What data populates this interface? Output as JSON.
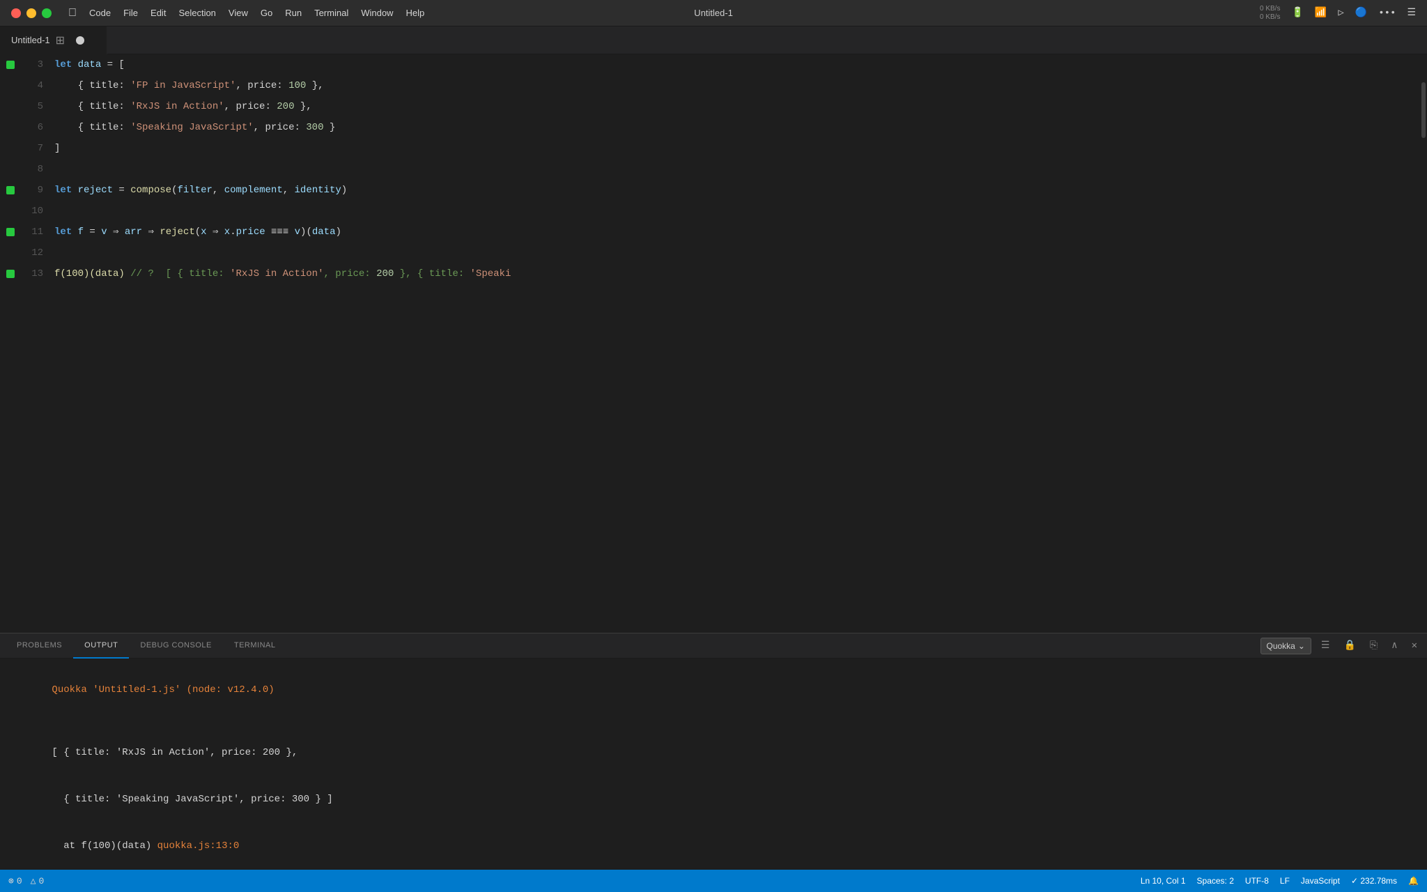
{
  "titlebar": {
    "title": "Untitled-1",
    "menu_items": [
      "",
      "Code",
      "File",
      "Edit",
      "Selection",
      "View",
      "Go",
      "Run",
      "Terminal",
      "Window",
      "Help"
    ],
    "status_kb": "0 KB/s",
    "status_kb2": "0 KB/s"
  },
  "editor": {
    "tab_label": "Untitled-1",
    "lines": [
      {
        "number": "3",
        "has_dot": true,
        "tokens": [
          {
            "text": "let ",
            "class": "kw"
          },
          {
            "text": "data",
            "class": "blue"
          },
          {
            "text": " = [",
            "class": "punct"
          }
        ]
      },
      {
        "number": "4",
        "has_dot": false,
        "tokens": [
          {
            "text": "    { title: ",
            "class": "punct"
          },
          {
            "text": "'FP in JavaScript'",
            "class": "str"
          },
          {
            "text": ", price: ",
            "class": "punct"
          },
          {
            "text": "100",
            "class": "num"
          },
          {
            "text": " },",
            "class": "punct"
          }
        ]
      },
      {
        "number": "5",
        "has_dot": false,
        "tokens": [
          {
            "text": "    { title: ",
            "class": "punct"
          },
          {
            "text": "'RxJS in Action'",
            "class": "str"
          },
          {
            "text": ", price: ",
            "class": "punct"
          },
          {
            "text": "200",
            "class": "num"
          },
          {
            "text": " },",
            "class": "punct"
          }
        ]
      },
      {
        "number": "6",
        "has_dot": false,
        "tokens": [
          {
            "text": "    { title: ",
            "class": "punct"
          },
          {
            "text": "'Speaking JavaScript'",
            "class": "str"
          },
          {
            "text": ", price: ",
            "class": "punct"
          },
          {
            "text": "300",
            "class": "num"
          },
          {
            "text": " }",
            "class": "punct"
          }
        ]
      },
      {
        "number": "7",
        "has_dot": false,
        "tokens": [
          {
            "text": "]",
            "class": "punct"
          }
        ]
      },
      {
        "number": "8",
        "has_dot": false,
        "tokens": []
      },
      {
        "number": "9",
        "has_dot": true,
        "tokens": [
          {
            "text": "let ",
            "class": "kw"
          },
          {
            "text": "reject",
            "class": "blue"
          },
          {
            "text": " = ",
            "class": "punct"
          },
          {
            "text": "compose",
            "class": "yellow"
          },
          {
            "text": "(",
            "class": "punct"
          },
          {
            "text": "filter",
            "class": "blue"
          },
          {
            "text": ", ",
            "class": "punct"
          },
          {
            "text": "complement",
            "class": "blue"
          },
          {
            "text": ", ",
            "class": "punct"
          },
          {
            "text": "identity",
            "class": "blue"
          },
          {
            "text": ")",
            "class": "punct"
          }
        ]
      },
      {
        "number": "10",
        "has_dot": false,
        "tokens": []
      },
      {
        "number": "11",
        "has_dot": true,
        "tokens": [
          {
            "text": "let ",
            "class": "kw"
          },
          {
            "text": "f",
            "class": "blue"
          },
          {
            "text": " = ",
            "class": "punct"
          },
          {
            "text": "v",
            "class": "blue"
          },
          {
            "text": " ⇒ ",
            "class": "punct"
          },
          {
            "text": "arr",
            "class": "blue"
          },
          {
            "text": " ⇒ ",
            "class": "punct"
          },
          {
            "text": "reject",
            "class": "yellow"
          },
          {
            "text": "(",
            "class": "punct"
          },
          {
            "text": "x",
            "class": "blue"
          },
          {
            "text": " ⇒ ",
            "class": "punct"
          },
          {
            "text": "x",
            "class": "blue"
          },
          {
            "text": ".",
            "class": "punct"
          },
          {
            "text": "price",
            "class": "blue"
          },
          {
            "text": " === ",
            "class": "punct"
          },
          {
            "text": "v",
            "class": "blue"
          },
          {
            "text": ")(",
            "class": "punct"
          },
          {
            "text": "data",
            "class": "blue"
          },
          {
            "text": ")",
            "class": "punct"
          }
        ]
      },
      {
        "number": "12",
        "has_dot": false,
        "tokens": []
      },
      {
        "number": "13",
        "has_dot": true,
        "tokens": [
          {
            "text": "f(100)(data) ",
            "class": "yellow"
          },
          {
            "text": "// ? ",
            "class": "comment"
          },
          {
            "text": "[ { title: ",
            "class": "comment"
          },
          {
            "text": "'RxJS in Action'",
            "class": "str"
          },
          {
            "text": ", price: ",
            "class": "comment"
          },
          {
            "text": "200",
            "class": "num"
          },
          {
            "text": " }, { title: ",
            "class": "comment"
          },
          {
            "text": "'Speaki",
            "class": "str"
          }
        ]
      }
    ]
  },
  "panel": {
    "tabs": [
      "PROBLEMS",
      "OUTPUT",
      "DEBUG CONSOLE",
      "TERMINAL"
    ],
    "active_tab": "OUTPUT",
    "dropdown_label": "Quokka",
    "output": {
      "line1": "Quokka 'Untitled-1.js' (node: v12.4.0)",
      "line2": "",
      "line3": "[ { title: 'RxJS in Action', price: 200 },",
      "line4": "  { title: 'Speaking JavaScript', price: 300 } ]",
      "line5": "  at f(100)(data) ",
      "line5_link": "quokka.js:13:0"
    }
  },
  "statusbar": {
    "errors": "0",
    "warnings": "0",
    "position": "Ln 10, Col 1",
    "spaces": "Spaces: 2",
    "encoding": "UTF-8",
    "line_ending": "LF",
    "language": "JavaScript",
    "timing": "✓ 232.78ms"
  },
  "icons": {
    "close": "✕",
    "minimize": "−",
    "maximize": "●",
    "split": "⊞",
    "circle": "●",
    "chevron_down": "⌄",
    "list": "☰",
    "lock": "🔒",
    "copy": "⎘",
    "up": "∧",
    "error": "⊗",
    "warning": "△",
    "notification": "🔔"
  }
}
